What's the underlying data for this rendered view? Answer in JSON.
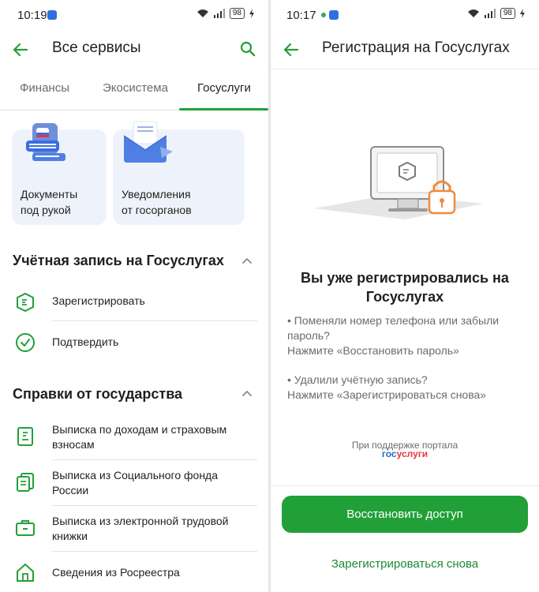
{
  "left": {
    "status": {
      "time": "10:19",
      "battery": "98"
    },
    "title": "Все сервисы",
    "tabs": [
      "Финансы",
      "Экосистема",
      "Госуслуги"
    ],
    "cards": [
      {
        "label_line1": "Документы",
        "label_line2": "под рукой"
      },
      {
        "label_line1": "Уведомления",
        "label_line2": "от госорганов"
      }
    ],
    "sections": [
      {
        "title": "Учётная запись на Госуслугах",
        "items": [
          {
            "label": "Зарегистрировать"
          },
          {
            "label": "Подтвердить"
          }
        ]
      },
      {
        "title": "Справки от государства",
        "items": [
          {
            "line1": "Выписка по доходам и страховым",
            "line2": "взносам"
          },
          {
            "line1": "Выписка из Социального фонда",
            "line2": "России"
          },
          {
            "line1": "Выписка из электронной трудовой",
            "line2": "книжки"
          },
          {
            "line1": "Сведения из Росреестра",
            "line2": ""
          }
        ]
      }
    ]
  },
  "right": {
    "status": {
      "time": "10:17",
      "battery": "98"
    },
    "title": "Регистрация на Госуслугах",
    "heading_line1": "Вы уже регистрировались на",
    "heading_line2": "Госуслугах",
    "tip1_line1": "• Поменяли номер телефона или забыли",
    "tip1_line2": "пароль?",
    "tip1_line3": "Нажмите «Восстановить пароль»",
    "tip2_line1": "• Удалили учётную запись?",
    "tip2_line2": "Нажмите «Зарегистрироваться снова»",
    "support_text": "При поддержке портала",
    "logo_part1": "гос",
    "logo_part2": "услуги",
    "primary_button": "Восстановить доступ",
    "secondary_button": "Зарегистрироваться снова"
  },
  "colors": {
    "accent": "#21a038",
    "card_bg": "#eef3fb",
    "lock": "#f08a3c"
  }
}
